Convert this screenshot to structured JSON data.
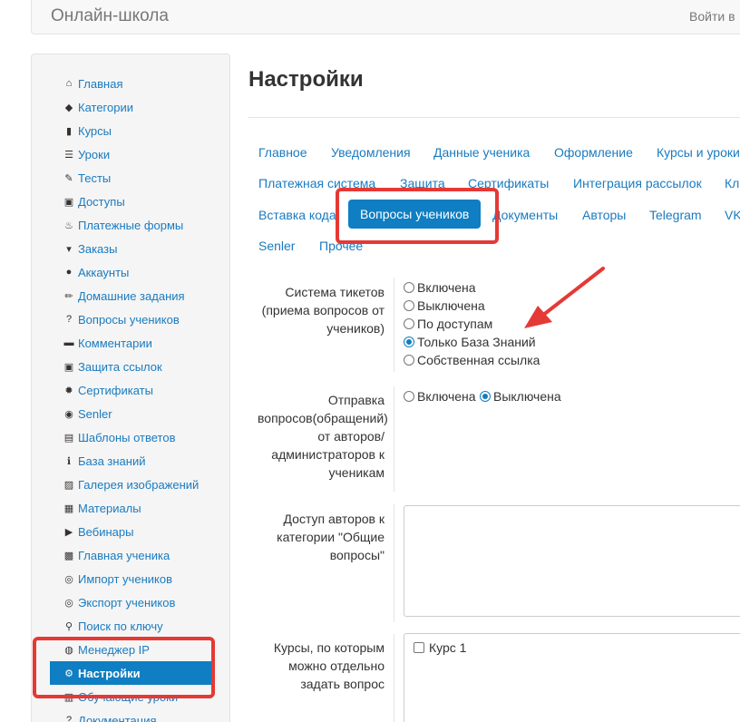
{
  "navbar": {
    "brand": "Онлайн-школа",
    "login": "Войти в"
  },
  "sidebar": {
    "items": [
      {
        "label": "Главная",
        "icon": "home-icon",
        "glyph": "⌂"
      },
      {
        "label": "Категории",
        "icon": "tag-icon",
        "glyph": "◆"
      },
      {
        "label": "Курсы",
        "icon": "book-icon",
        "glyph": "▮"
      },
      {
        "label": "Уроки",
        "icon": "list-icon",
        "glyph": "☰"
      },
      {
        "label": "Тесты",
        "icon": "edit-icon",
        "glyph": "✎"
      },
      {
        "label": "Доступы",
        "icon": "lock-icon",
        "glyph": "▣"
      },
      {
        "label": "Платежные формы",
        "icon": "fire-icon",
        "glyph": "♨"
      },
      {
        "label": "Заказы",
        "icon": "cart-icon",
        "glyph": "▾"
      },
      {
        "label": "Аккаунты",
        "icon": "user-icon",
        "glyph": "●"
      },
      {
        "label": "Домашние задания",
        "icon": "pencil-icon",
        "glyph": "✏"
      },
      {
        "label": "Вопросы учеников",
        "icon": "question-icon",
        "glyph": "?"
      },
      {
        "label": "Комментарии",
        "icon": "comment-icon",
        "glyph": "▬"
      },
      {
        "label": "Защита ссылок",
        "icon": "lock-icon",
        "glyph": "▣"
      },
      {
        "label": "Сертификаты",
        "icon": "certificate-icon",
        "glyph": "✹"
      },
      {
        "label": "Senler",
        "icon": "circle-play-icon",
        "glyph": "◉"
      },
      {
        "label": "Шаблоны ответов",
        "icon": "template-icon",
        "glyph": "▤"
      },
      {
        "label": "База знаний",
        "icon": "info-icon",
        "glyph": "ℹ"
      },
      {
        "label": "Галерея изображений",
        "icon": "picture-icon",
        "glyph": "▨"
      },
      {
        "label": "Материалы",
        "icon": "briefcase-icon",
        "glyph": "▦"
      },
      {
        "label": "Вебинары",
        "icon": "play-icon",
        "glyph": "▶"
      },
      {
        "label": "Главная ученика",
        "icon": "grid-icon",
        "glyph": "▩"
      },
      {
        "label": "Импорт учеников",
        "icon": "import-icon",
        "glyph": "◎"
      },
      {
        "label": "Экспорт учеников",
        "icon": "export-icon",
        "glyph": "◎"
      },
      {
        "label": "Поиск по ключу",
        "icon": "search-icon",
        "glyph": "⚲"
      },
      {
        "label": "Менеджер IP",
        "icon": "globe-icon",
        "glyph": "◍"
      },
      {
        "label": "Настройки",
        "icon": "gear-icon",
        "glyph": "⚙",
        "active": true
      },
      {
        "label": "Обучающие уроки",
        "icon": "film-icon",
        "glyph": "▥"
      },
      {
        "label": "Документация",
        "icon": "question-icon",
        "glyph": "?"
      }
    ]
  },
  "main": {
    "title": "Настройки",
    "tabs": [
      {
        "label": "Главное"
      },
      {
        "label": "Уведомления"
      },
      {
        "label": "Данные ученика"
      },
      {
        "label": "Оформление"
      },
      {
        "label": "Курсы и уроки"
      },
      {
        "label": "Платежная система"
      },
      {
        "label": "Защита"
      },
      {
        "label": "Сертификаты"
      },
      {
        "label": "Интеграция рассылок"
      },
      {
        "label": "Кл"
      },
      {
        "label": "Вставка кода"
      },
      {
        "label": "Вопросы учеников",
        "active": true
      },
      {
        "label": "Документы"
      },
      {
        "label": "Авторы"
      },
      {
        "label": "Telegram"
      },
      {
        "label": "VK"
      },
      {
        "label": "Senler"
      },
      {
        "label": "Прочее"
      }
    ],
    "ticket_system": {
      "label": "Система тикетов (приема вопросов от учеников)",
      "options": [
        "Включена",
        "Выключена",
        "По доступам",
        "Только База Знаний",
        "Собственная ссылка"
      ],
      "selected": "Только База Знаний"
    },
    "send_questions": {
      "label": "Отправка вопросов(обращений) от авторов/ администраторов к ученикам",
      "options": [
        "Включена",
        "Выключена"
      ],
      "selected": "Выключена"
    },
    "authors_access": {
      "label": "Доступ авторов к категории \"Общие вопросы\"",
      "value": ""
    },
    "courses": {
      "label": "Курсы, по которым можно отдельно задать вопрос",
      "items": [
        {
          "label": "Курс 1",
          "checked": false
        }
      ]
    }
  },
  "colors": {
    "accent": "#0f7ec2",
    "link": "#1a7bc0",
    "annotation": "#e53935"
  }
}
